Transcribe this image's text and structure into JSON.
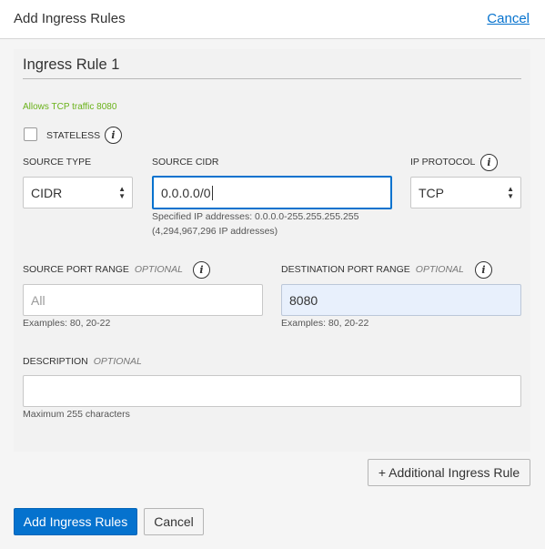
{
  "header": {
    "title": "Add Ingress Rules",
    "cancel_link": "Cancel"
  },
  "rule": {
    "title": "Ingress Rule 1",
    "hint": "Allows TCP traffic 8080",
    "stateless": {
      "label": "STATELESS",
      "checked": false,
      "info": "i"
    },
    "source_type": {
      "label": "SOURCE TYPE",
      "value": "CIDR"
    },
    "source_cidr": {
      "label": "SOURCE CIDR",
      "value": "0.0.0.0/0",
      "help_line1": "Specified IP addresses: 0.0.0.0-255.255.255.255",
      "help_line2": "(4,294,967,296 IP addresses)"
    },
    "ip_protocol": {
      "label": "IP PROTOCOL",
      "value": "TCP",
      "info": "i"
    },
    "source_port_range": {
      "label": "SOURCE PORT RANGE",
      "optional": "OPTIONAL",
      "placeholder": "All",
      "help": "Examples: 80, 20-22",
      "info": "i"
    },
    "destination_port_range": {
      "label": "DESTINATION PORT RANGE",
      "optional": "OPTIONAL",
      "value": "8080",
      "help": "Examples: 80, 20-22",
      "info": "i"
    },
    "description": {
      "label": "DESCRIPTION",
      "optional": "OPTIONAL",
      "value": "",
      "help": "Maximum 255 characters"
    }
  },
  "buttons": {
    "additional_rule": "+ Additional Ingress Rule",
    "add_rules": "Add Ingress Rules",
    "cancel": "Cancel"
  },
  "colors": {
    "accent": "#0572ce",
    "hint_green": "#6ab21a",
    "filled_field_bg": "#e8f0fc"
  }
}
